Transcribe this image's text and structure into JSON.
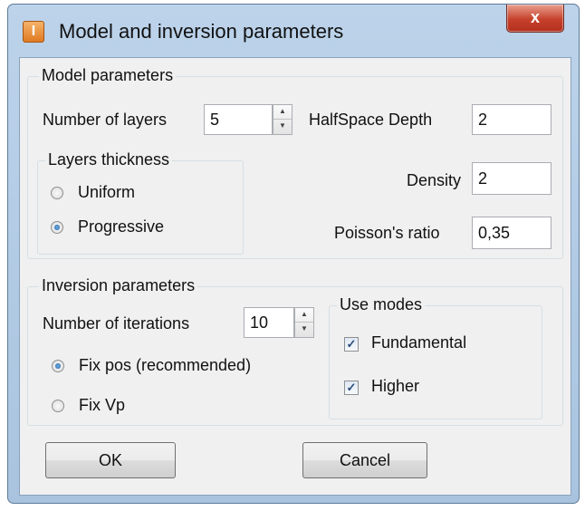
{
  "window": {
    "title": "Model and inversion parameters",
    "close_label": "x",
    "icon_glyph": "I"
  },
  "model": {
    "legend": "Model parameters",
    "layers_label": "Number of layers",
    "layers_value": "5",
    "halfspace_label": "HalfSpace Depth",
    "halfspace_value": "2",
    "density_label": "Density",
    "density_value": "2",
    "poisson_label": "Poisson's ratio",
    "poisson_value": "0,35",
    "thickness": {
      "legend": "Layers thickness",
      "uniform_label": "Uniform",
      "progressive_label": "Progressive",
      "selected": "Progressive"
    }
  },
  "inversion": {
    "legend": "Inversion parameters",
    "iterations_label": "Number of iterations",
    "iterations_value": "10",
    "fixpos_label": "Fix pos (recommended)",
    "fixvp_label": "Fix Vp",
    "selected": "Fix pos (recommended)",
    "modes": {
      "legend": "Use modes",
      "fundamental_label": "Fundamental",
      "fundamental_checked": true,
      "higher_label": "Higher",
      "higher_checked": true
    }
  },
  "buttons": {
    "ok_label": "OK",
    "cancel_label": "Cancel"
  }
}
